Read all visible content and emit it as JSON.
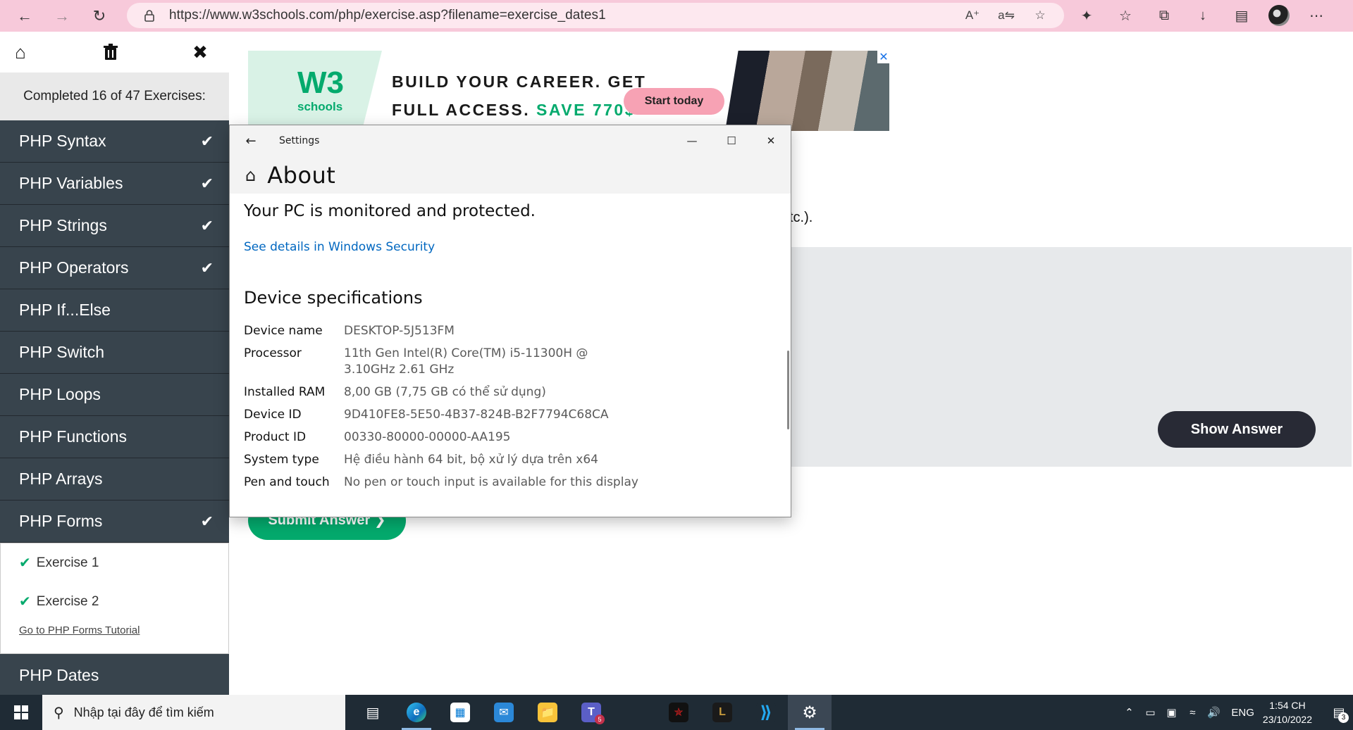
{
  "browser": {
    "url": "https://www.w3schools.com/php/exercise.asp?filename=exercise_dates1"
  },
  "sidebar": {
    "completed_text": "Completed 16 of 47 Exercises:",
    "lessons": [
      {
        "label": "PHP Syntax",
        "done": true
      },
      {
        "label": "PHP Variables",
        "done": true
      },
      {
        "label": "PHP Strings",
        "done": true
      },
      {
        "label": "PHP Operators",
        "done": true
      },
      {
        "label": "PHP If...Else",
        "done": false
      },
      {
        "label": "PHP Switch",
        "done": false
      },
      {
        "label": "PHP Loops",
        "done": false
      },
      {
        "label": "PHP Functions",
        "done": false
      },
      {
        "label": "PHP Arrays",
        "done": false
      },
      {
        "label": "PHP Forms",
        "done": true
      }
    ],
    "exercises": [
      "Exercise 1",
      "Exercise 2"
    ],
    "tutorial_link": "Go to PHP Forms Tutorial",
    "current_lesson": "PHP Dates"
  },
  "ad": {
    "logo_big": "W3",
    "logo_small": "schools",
    "line1": "BUILD YOUR CAREER. GET",
    "line2_prefix": "FULL ACCESS. ",
    "line2_highlight": "SAVE 770$",
    "button": "Start today"
  },
  "page": {
    "partial_text": "tc.).",
    "show_answer": "Show Answer",
    "submit_answer": "Submit Answer ❯"
  },
  "settings": {
    "window_title": "Settings",
    "heading": "About",
    "protection_text": "Your PC is monitored and protected.",
    "security_link": "See details in Windows Security",
    "specs_heading": "Device specifications",
    "specs": [
      {
        "label": "Device name",
        "value": "DESKTOP-5J513FM"
      },
      {
        "label": "Processor",
        "value": "11th Gen Intel(R) Core(TM) i5-11300H @ 3.10GHz   2.61 GHz"
      },
      {
        "label": "Installed RAM",
        "value": "8,00 GB (7,75 GB có thể sử dụng)"
      },
      {
        "label": "Device ID",
        "value": "9D410FE8-5E50-4B37-824B-B2F7794C68CA"
      },
      {
        "label": "Product ID",
        "value": "00330-80000-00000-AA195"
      },
      {
        "label": "System type",
        "value": "Hệ điều hành 64 bit, bộ xử lý dựa trên x64"
      },
      {
        "label": "Pen and touch",
        "value": "No pen or touch input is available for this display"
      }
    ]
  },
  "taskbar": {
    "search_placeholder": "Nhập tại đây để tìm kiếm",
    "language": "ENG",
    "time": "1:54 CH",
    "date": "23/10/2022",
    "notification_count": "3",
    "teams_badge": "5"
  },
  "colors": {
    "browser_bar": "#f7c9da",
    "sidebar_dark": "#38444d",
    "w3_green": "#04aa6d",
    "taskbar": "#1f2b35"
  }
}
